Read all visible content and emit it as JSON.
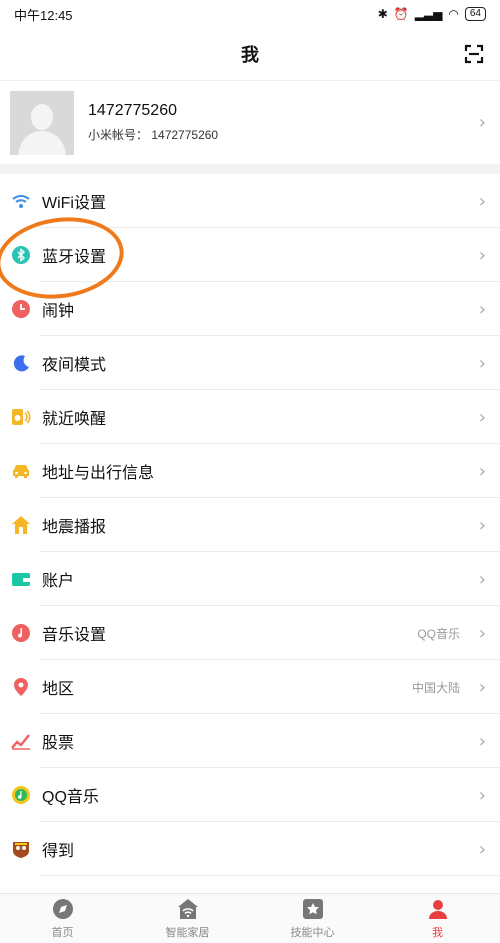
{
  "status": {
    "time": "中午12:45",
    "battery": "64"
  },
  "header": {
    "title": "我"
  },
  "profile": {
    "name": "1472775260",
    "account_label": "小米帐号：",
    "account_value": "1472775260"
  },
  "menu": [
    {
      "label": "WiFi设置",
      "value": "",
      "icon": "wifi-icon"
    },
    {
      "label": "蓝牙设置",
      "value": "",
      "icon": "bluetooth-icon"
    },
    {
      "label": "闹钟",
      "value": "",
      "icon": "alarm-icon"
    },
    {
      "label": "夜间模式",
      "value": "",
      "icon": "moon-icon"
    },
    {
      "label": "就近唤醒",
      "value": "",
      "icon": "speaker-icon"
    },
    {
      "label": "地址与出行信息",
      "value": "",
      "icon": "car-icon"
    },
    {
      "label": "地震播报",
      "value": "",
      "icon": "house-icon"
    },
    {
      "label": "账户",
      "value": "",
      "icon": "wallet-icon"
    },
    {
      "label": "音乐设置",
      "value": "QQ音乐",
      "icon": "music-icon"
    },
    {
      "label": "地区",
      "value": "中国大陆",
      "icon": "location-pin-icon"
    },
    {
      "label": "股票",
      "value": "",
      "icon": "stock-chart-icon"
    },
    {
      "label": "QQ音乐",
      "value": "",
      "icon": "qq-music-icon"
    },
    {
      "label": "得到",
      "value": "",
      "icon": "dedao-icon"
    }
  ],
  "tabs": [
    {
      "label": "首页",
      "icon": "compass-icon",
      "active": false
    },
    {
      "label": "智能家居",
      "icon": "smart-home-icon",
      "active": false
    },
    {
      "label": "技能中心",
      "icon": "star-icon",
      "active": false
    },
    {
      "label": "我",
      "icon": "user-icon",
      "active": true
    }
  ],
  "colors": {
    "accent": "#e84040",
    "highlight_circle": "#f07a1a",
    "bluetooth": "#2bc4b4",
    "wifi": "#3a8ee6"
  }
}
